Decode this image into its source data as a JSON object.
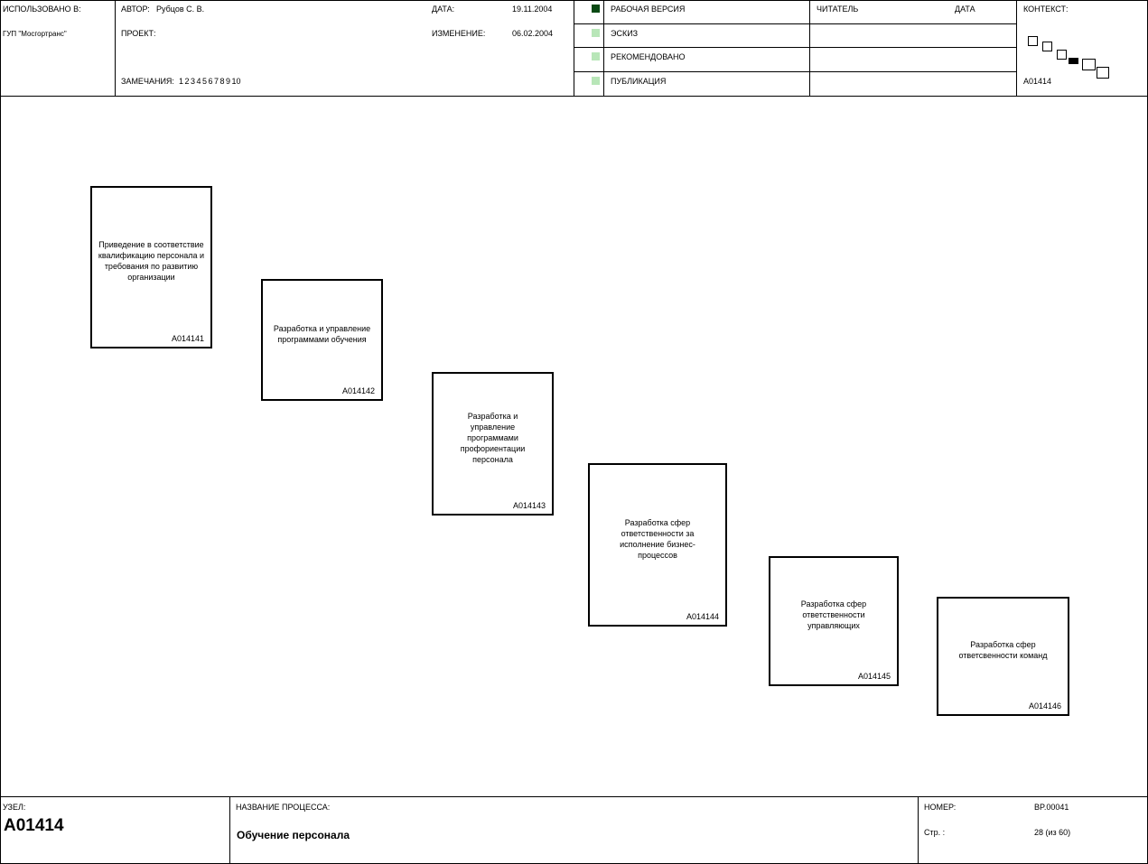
{
  "header": {
    "used_at_label": "ИСПОЛЬЗОВАНО В:",
    "used_at_value": "ГУП \"Мосгортранс\"",
    "author_label": "АВТОР:",
    "author_value": "Рубцов С. В.",
    "project_label": "ПРОЕКТ:",
    "date_label": "ДАТА:",
    "date_value": "19.11.2004",
    "change_label": "ИЗМЕНЕНИЕ:",
    "change_value": "06.02.2004",
    "notes_label": "ЗАМЕЧАНИЯ:",
    "notes_numbers": "1  2  3  4  5  6  7  8  9  10",
    "status": [
      {
        "label": "РАБОЧАЯ ВЕРСИЯ",
        "checked": true
      },
      {
        "label": "ЭСКИЗ",
        "checked": false
      },
      {
        "label": "РЕКОМЕНДОВАНО",
        "checked": false
      },
      {
        "label": "ПУБЛИКАЦИЯ",
        "checked": false
      }
    ],
    "reader_label": "ЧИТАТЕЛЬ",
    "reader_date_label": "ДАТА",
    "context_label": "КОНТЕКСТ:",
    "context_node": "A01414"
  },
  "diagram": {
    "boxes": [
      {
        "label": "Приведение в соответствие квалификацию персонала и требования по развитию организации",
        "number": "A014141"
      },
      {
        "label": "Разработка и управление программами обучения",
        "number": "A014142"
      },
      {
        "label": "Разработка и управление программами профориентации персонала",
        "number": "A014143"
      },
      {
        "label": "Разработка сфер ответственности за исполнение бизнес-процессов",
        "number": "A014144"
      },
      {
        "label": "Разработка сфер ответственности управляющих",
        "number": "A014145"
      },
      {
        "label": "Разработка сфер ответсвенности команд",
        "number": "A014146"
      }
    ]
  },
  "footer": {
    "node_label": "УЗЕЛ:",
    "node_value": "A01414",
    "process_name_label": "НАЗВАНИЕ ПРОЦЕССА:",
    "process_name_value": "Обучение персонала",
    "number_label": "НОМЕР:",
    "number_value": "BP.00041",
    "page_label": "Стр. :",
    "page_value": "28 (из 60)"
  }
}
